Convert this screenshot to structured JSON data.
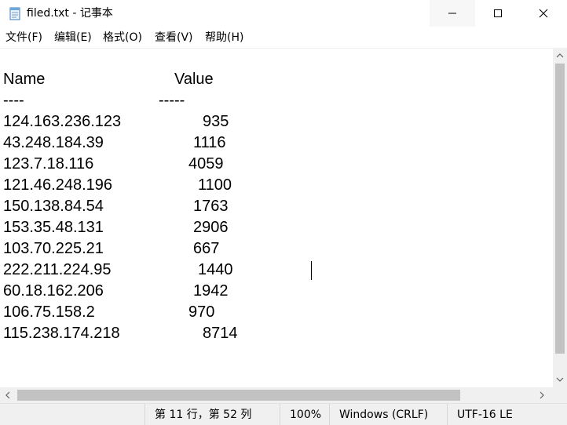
{
  "window": {
    "title": "filed.txt - 记事本",
    "icon": "notepad-icon",
    "controls": {
      "minimize_icon": "minimize-icon",
      "maximize_icon": "maximize-icon",
      "close_icon": "close-icon"
    }
  },
  "menu": {
    "items": [
      {
        "label": "文件(F)"
      },
      {
        "label": "编辑(E)"
      },
      {
        "label": "格式(O)"
      },
      {
        "label": "查看(V)"
      },
      {
        "label": "帮助(H)"
      }
    ]
  },
  "document": {
    "header": {
      "name": "Name",
      "value": "Value"
    },
    "separator": {
      "name": "----",
      "value": "-----"
    },
    "rows": [
      {
        "name": "124.163.236.123",
        "value": "935"
      },
      {
        "name": "43.248.184.39",
        "value": "1116"
      },
      {
        "name": "123.7.18.116",
        "value": "4059"
      },
      {
        "name": "121.46.248.196",
        "value": "1100"
      },
      {
        "name": "150.138.84.54",
        "value": "1763"
      },
      {
        "name": "153.35.48.131",
        "value": "2906"
      },
      {
        "name": "103.70.225.21",
        "value": "667"
      },
      {
        "name": "222.211.224.95",
        "value": "1440"
      },
      {
        "name": "60.18.162.206",
        "value": "1942"
      },
      {
        "name": "106.75.158.2",
        "value": "970"
      },
      {
        "name": "115.238.174.218",
        "value": "8714"
      }
    ]
  },
  "statusbar": {
    "position": "第 11 行，第 52 列",
    "zoom": "100%",
    "line_ending": "Windows (CRLF)",
    "encoding": "UTF-16 LE"
  },
  "scrollbars": {
    "left_arrow_icon": "scroll-left-icon",
    "right_arrow_icon": "scroll-right-icon",
    "up_arrow_icon": "scroll-up-icon",
    "down_arrow_icon": "scroll-down-icon"
  }
}
